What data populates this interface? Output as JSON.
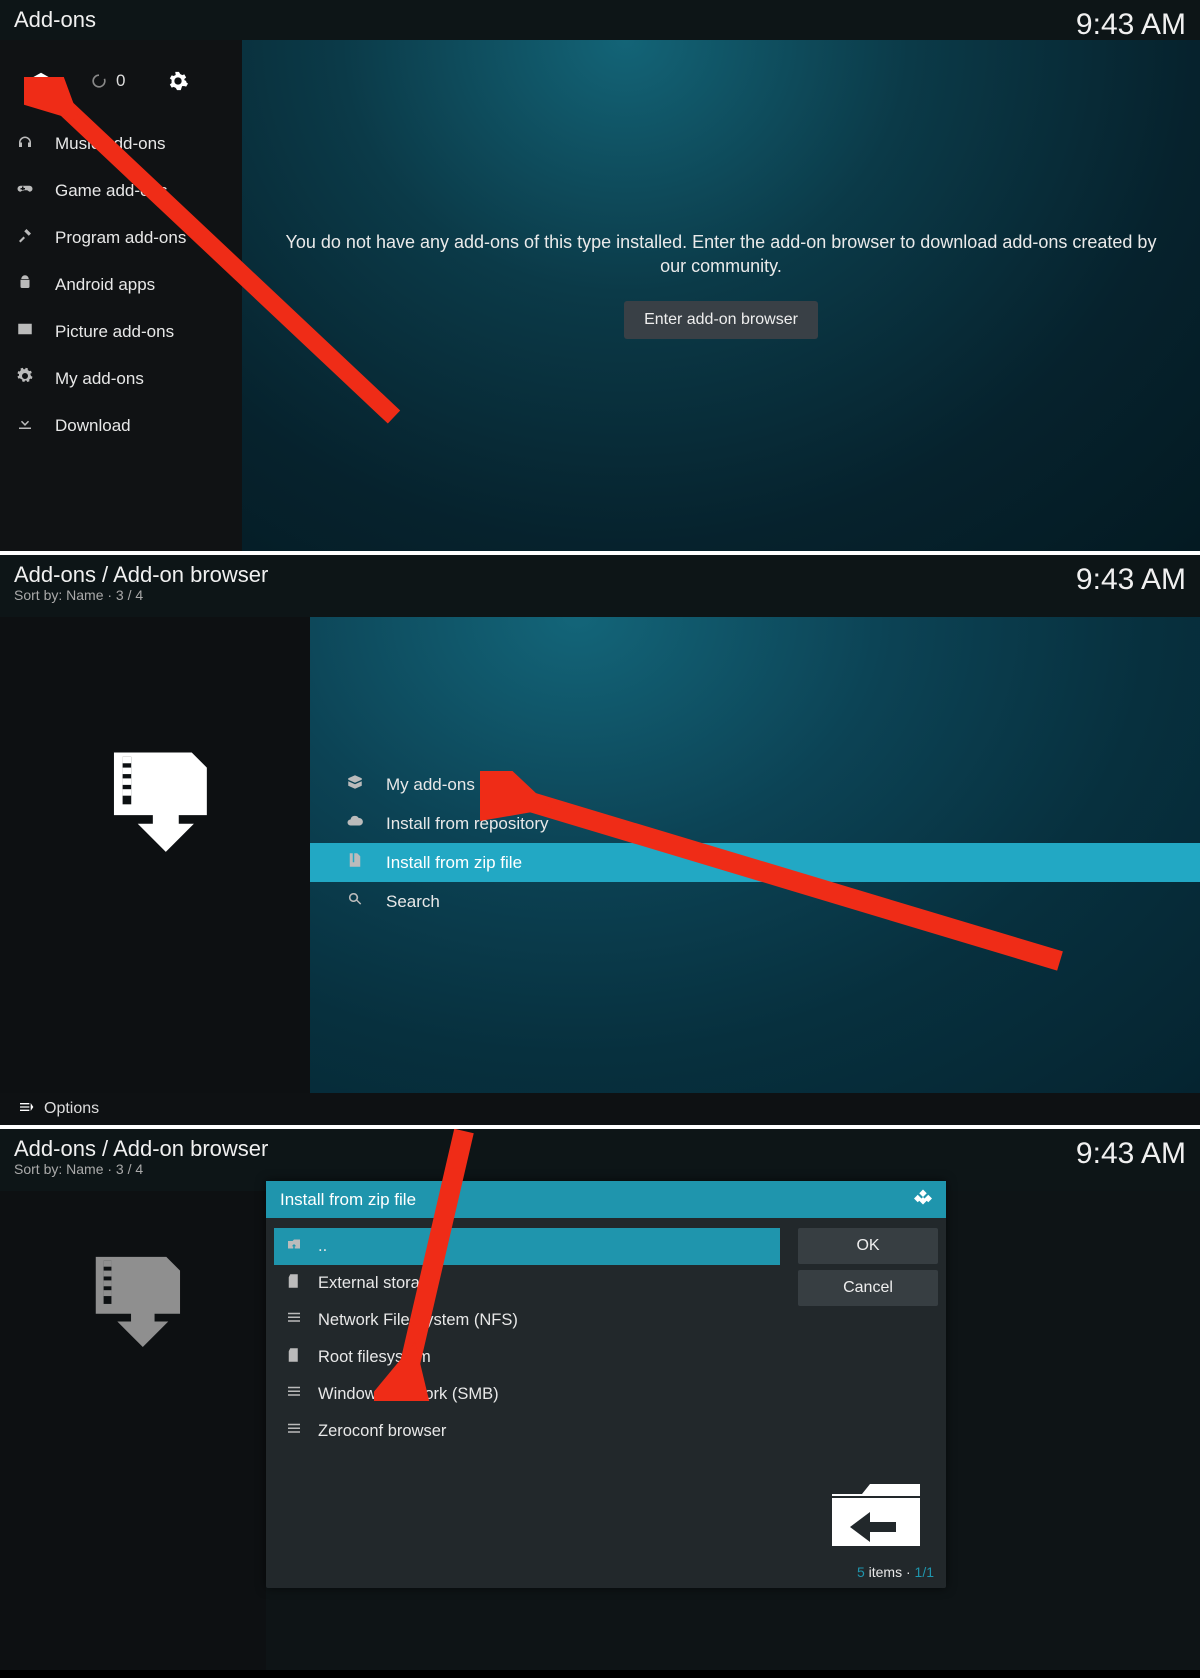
{
  "clock": "9:43 AM",
  "screen1": {
    "title": "Add-ons",
    "refresh_count": "0",
    "empty_msg": "You do not have any add-ons of this type installed. Enter the add-on browser to download add-ons created by our community.",
    "enter_btn": "Enter add-on browser",
    "sidebar": [
      {
        "icon": "headphones-icon",
        "label": "Music add-ons"
      },
      {
        "icon": "gamepad-icon",
        "label": "Game add-ons"
      },
      {
        "icon": "tools-icon",
        "label": "Program add-ons"
      },
      {
        "icon": "android-icon",
        "label": "Android apps"
      },
      {
        "icon": "picture-icon",
        "label": "Picture add-ons"
      },
      {
        "icon": "gears-icon",
        "label": "My add-ons"
      },
      {
        "icon": "download-icon",
        "label": "Download"
      }
    ]
  },
  "screen2": {
    "title": "Add-ons / Add-on browser",
    "subtitle": "Sort by: Name  ·  3 / 4",
    "options_label": "Options",
    "rows": [
      {
        "icon": "box-icon",
        "label": "My add-ons"
      },
      {
        "icon": "cloud-icon",
        "label": "Install from repository"
      },
      {
        "icon": "zip-icon",
        "label": "Install from zip file",
        "selected": true
      },
      {
        "icon": "search-icon",
        "label": "Search"
      }
    ]
  },
  "screen3": {
    "title": "Add-ons / Add-on browser",
    "subtitle": "Sort by: Name  ·  3 / 4",
    "dialog_title": "Install from zip file",
    "ok": "OK",
    "cancel": "Cancel",
    "footer_count": "5",
    "footer_items": " items · ",
    "footer_page": "1/1",
    "files": [
      {
        "icon": "up-icon",
        "label": "..",
        "selected": true
      },
      {
        "icon": "sdcard-icon",
        "label": "External storage"
      },
      {
        "icon": "network-icon",
        "label": "Network File System (NFS)"
      },
      {
        "icon": "sdcard-icon",
        "label": "Root filesystem"
      },
      {
        "icon": "network-icon",
        "label": "Windows network (SMB)"
      },
      {
        "icon": "network-icon",
        "label": "Zeroconf browser"
      }
    ]
  }
}
